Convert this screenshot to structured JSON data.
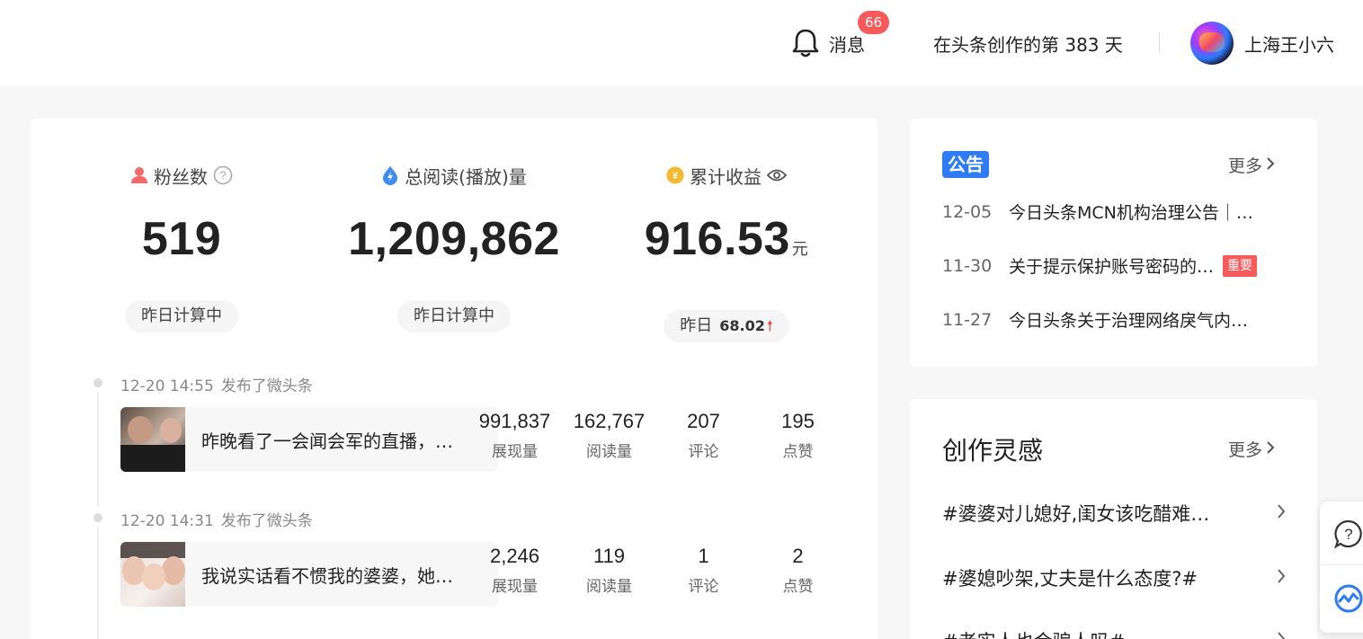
{
  "header": {
    "messages_label": "消息",
    "messages_badge": "66",
    "creation_days": "在头条创作的第 383 天",
    "username": "上海王小六"
  },
  "stats": {
    "fans": {
      "label": "粉丝数",
      "value": "519",
      "sub": "昨日计算中"
    },
    "reads": {
      "label": "总阅读(播放)量",
      "value": "1,209,862",
      "sub": "昨日计算中"
    },
    "income": {
      "label": "累计收益",
      "value": "916.53",
      "unit": "元",
      "sub_label": "昨日",
      "sub_value": "68.02"
    }
  },
  "posts": [
    {
      "time": "12-20 14:55",
      "action": "发布了微头条",
      "title": "昨晚看了一会闻会军的直播，…",
      "metrics": [
        {
          "value": "991,837",
          "label": "展现量"
        },
        {
          "value": "162,767",
          "label": "阅读量"
        },
        {
          "value": "207",
          "label": "评论"
        },
        {
          "value": "195",
          "label": "点赞"
        }
      ]
    },
    {
      "time": "12-20 14:31",
      "action": "发布了微头条",
      "title": "我说实话看不惯我的婆婆，她…",
      "metrics": [
        {
          "value": "2,246",
          "label": "展现量"
        },
        {
          "value": "119",
          "label": "阅读量"
        },
        {
          "value": "1",
          "label": "评论"
        },
        {
          "value": "2",
          "label": "点赞"
        }
      ]
    }
  ],
  "notice": {
    "tag": "公告",
    "more": "更多",
    "items": [
      {
        "date": "12-05",
        "text": "今日头条MCN机构治理公告｜…"
      },
      {
        "date": "11-30",
        "text": "关于提示保护账号密码的…",
        "badge": "重要"
      },
      {
        "date": "11-27",
        "text": "今日头条关于治理网络戾气内…"
      }
    ]
  },
  "inspiration": {
    "title": "创作灵感",
    "more": "更多",
    "items": [
      {
        "text": "#婆婆对儿媳好,闺女该吃醋难…"
      },
      {
        "text": "#婆媳吵架,丈夫是什么态度?#"
      },
      {
        "text": "#老实人也会骗人吗#"
      }
    ]
  },
  "icons": {
    "bell": "bell-icon",
    "fans": "user-icon",
    "reads": "lightning-icon",
    "income": "coin-icon",
    "eye": "eye-icon",
    "help": "help-icon",
    "float_help": "help-bubble-icon",
    "float_tool": "data-tool-icon"
  },
  "colors": {
    "accent_blue": "#2f7bf5",
    "badge_red": "#f85959",
    "fans_icon": "#f46a6a",
    "reads_icon": "#3d8bf5",
    "income_icon": "#f5b82e"
  }
}
